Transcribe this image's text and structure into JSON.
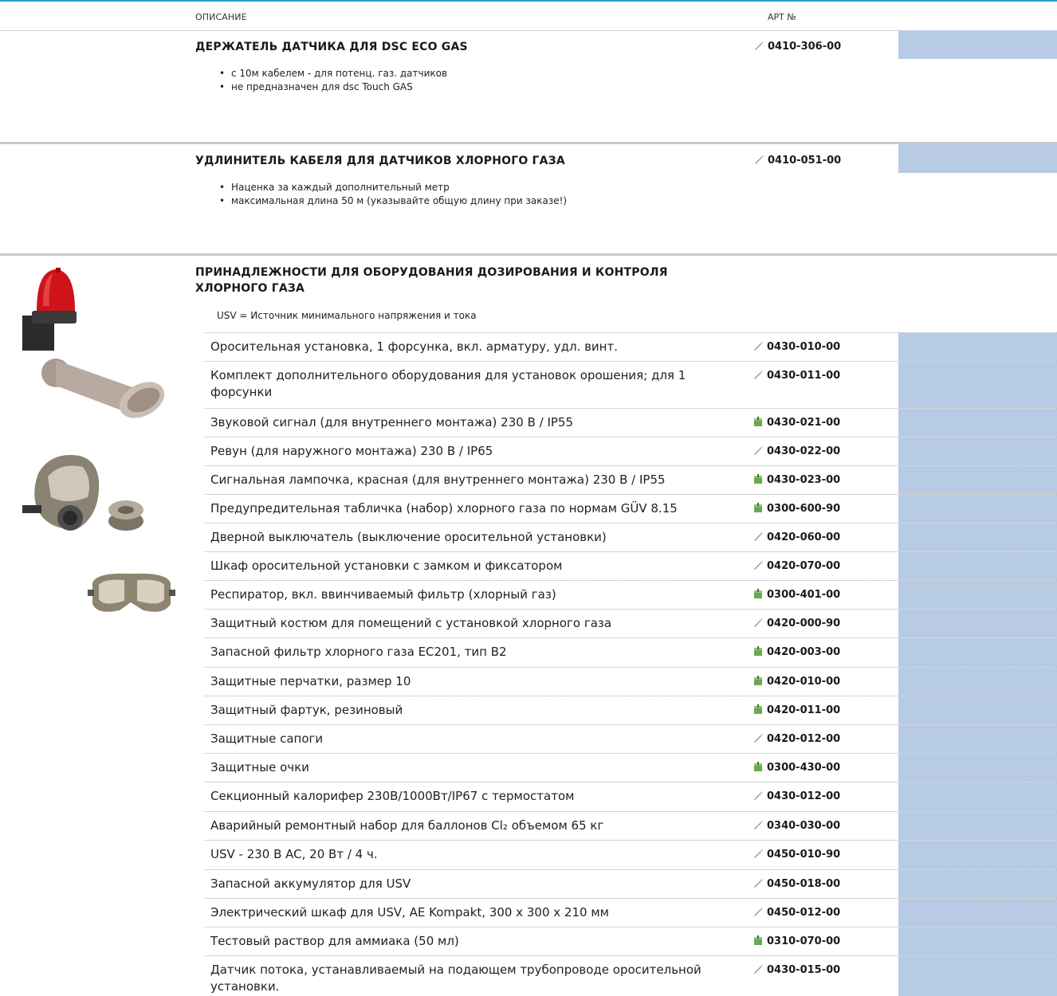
{
  "header": {
    "col_description": "ОПИСАНИЕ",
    "col_article": "АРТ №"
  },
  "section1": {
    "title": "ДЕРЖАТЕЛЬ ДАТЧИКА ДЛЯ DSC ECO GAS",
    "article": "0410-306-00",
    "icon": "pencil-icon",
    "bullets": [
      "с 10м кабелем - для потенц. газ. датчиков",
      "не предназначен для dsc Touch GAS"
    ]
  },
  "section2": {
    "title": "УДЛИНИТЕЛЬ КАБЕЛЯ ДЛЯ ДАТЧИКОВ ХЛОРНОГО ГАЗА",
    "article": "0410-051-00",
    "icon": "pencil-icon",
    "bullets": [
      "Наценка за каждый дополнительный метр",
      "максимальная длина 50 м (указывайте общую длину при заказе!)"
    ]
  },
  "section3": {
    "title": "ПРИНАДЛЕЖНОСТИ ДЛЯ ОБОРУДОВАНИЯ ДОЗИРОВАНИЯ И КОНТРОЛЯ ХЛОРНОГО ГАЗА",
    "note": "USV = Источник минимального напряжения и тока",
    "images": [
      "red-beacon-lamp",
      "horn-siren",
      "respirator-mask-with-filter",
      "safety-goggles"
    ],
    "rows": [
      {
        "desc": "Оросительная установка, 1 форсунка, вкл. арматуру, удл. винт.",
        "code": "0430-010-00",
        "icon": "pencil-icon"
      },
      {
        "desc": "Комплект дополнительного оборудования для установок орошения; для 1 форсунки",
        "code": "0430-011-00",
        "icon": "pencil-icon"
      },
      {
        "desc": "Звуковой сигнал (для внутреннего монтажа) 230 В / IP55",
        "code": "0430-021-00",
        "icon": "stock-box-icon"
      },
      {
        "desc": "Ревун (для наружного монтажа) 230 В / IP65",
        "code": "0430-022-00",
        "icon": "pencil-icon"
      },
      {
        "desc": "Сигнальная лампочка, красная (для внутреннего монтажа) 230 В / IP55",
        "code": "0430-023-00",
        "icon": "stock-box-icon"
      },
      {
        "desc": "Предупредительная табличка (набор) хлорного газа по нормам GÜV 8.15",
        "code": "0300-600-90",
        "icon": "stock-box-icon"
      },
      {
        "desc": "Дверной выключатель (выключение оросительной установки)",
        "code": "0420-060-00",
        "icon": "pencil-icon"
      },
      {
        "desc": "Шкаф оросительной установки с замком и фиксатором",
        "code": "0420-070-00",
        "icon": "pencil-icon"
      },
      {
        "desc": "Респиратор, вкл. ввинчиваемый фильтр (хлорный газ)",
        "code": "0300-401-00",
        "icon": "stock-box-icon"
      },
      {
        "desc": "Защитный костюм для помещений с установкой хлорного газа",
        "code": "0420-000-90",
        "icon": "pencil-icon"
      },
      {
        "desc": "Запасной фильтр хлорного газа EC201, тип B2",
        "code": "0420-003-00",
        "icon": "stock-box-icon"
      },
      {
        "desc": "Защитные перчатки, размер 10",
        "code": "0420-010-00",
        "icon": "stock-box-icon"
      },
      {
        "desc": "Защитный фартук, резиновый",
        "code": "0420-011-00",
        "icon": "stock-box-icon"
      },
      {
        "desc": "Защитные сапоги",
        "code": "0420-012-00",
        "icon": "pencil-icon"
      },
      {
        "desc": "Защитные очки",
        "code": "0300-430-00",
        "icon": "stock-box-icon"
      },
      {
        "desc": "Секционный калорифер 230В/1000Вт/IP67 с термостатом",
        "code": "0430-012-00",
        "icon": "pencil-icon"
      },
      {
        "desc": "Аварийный ремонтный набор для баллонов Cl₂ объемом 65 кг",
        "code": "0340-030-00",
        "icon": "pencil-icon"
      },
      {
        "desc": "USV - 230 В AC, 20 Вт / 4 ч.",
        "code": "0450-010-90",
        "icon": "pencil-icon"
      },
      {
        "desc": "Запасной аккумулятор для USV",
        "code": "0450-018-00",
        "icon": "pencil-icon"
      },
      {
        "desc": "Электрический шкаф для USV, AE Kompakt, 300 x 300 x 210 мм",
        "code": "0450-012-00",
        "icon": "pencil-icon"
      },
      {
        "desc": "Тестовый раствор для аммиака (50 мл)",
        "code": "0310-070-00",
        "icon": "stock-box-icon"
      },
      {
        "desc": "Датчик потока, устанавливаемый на подающем трубопроводе оросительной установки.",
        "code": "0430-015-00",
        "icon": "pencil-icon"
      }
    ]
  }
}
